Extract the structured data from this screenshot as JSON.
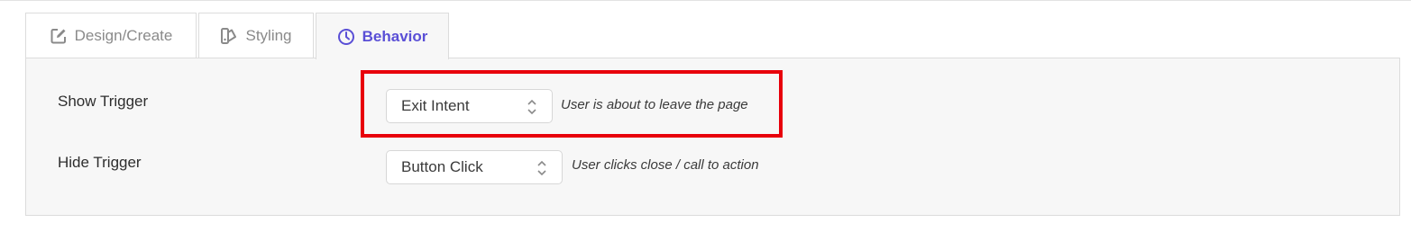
{
  "tabs": [
    {
      "label": "Design/Create",
      "icon": "edit-icon"
    },
    {
      "label": "Styling",
      "icon": "styling-icon"
    },
    {
      "label": "Behavior",
      "icon": "clock-icon",
      "active": true
    }
  ],
  "behavior": {
    "show_trigger": {
      "label": "Show Trigger",
      "value": "Exit Intent",
      "hint": "User is about to leave the page"
    },
    "hide_trigger": {
      "label": "Hide Trigger",
      "value": "Button Click",
      "hint": "User clicks close / call to action"
    }
  },
  "colors": {
    "accent": "#5a4fd6",
    "highlight": "#e8000b"
  }
}
